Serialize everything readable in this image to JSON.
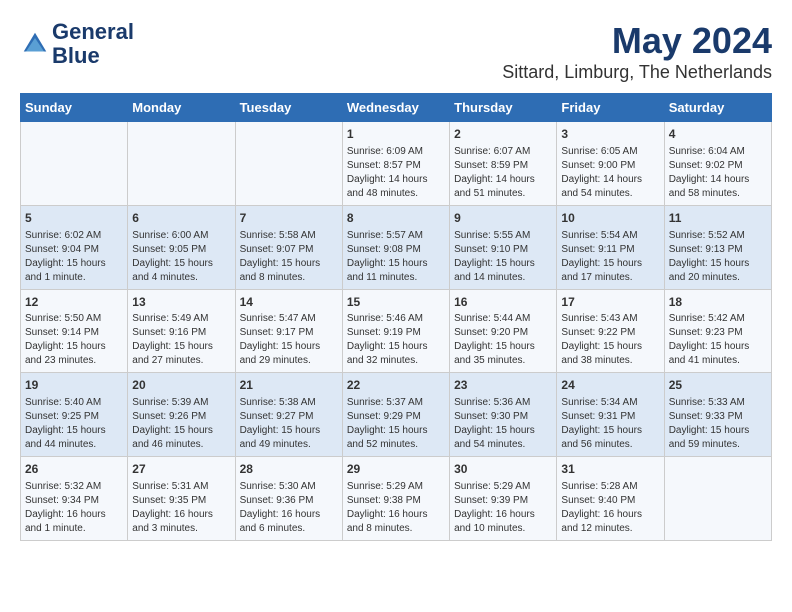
{
  "header": {
    "logo_line1": "General",
    "logo_line2": "Blue",
    "title": "May 2024",
    "subtitle": "Sittard, Limburg, The Netherlands"
  },
  "days_of_week": [
    "Sunday",
    "Monday",
    "Tuesday",
    "Wednesday",
    "Thursday",
    "Friday",
    "Saturday"
  ],
  "weeks": [
    [
      {
        "day": "",
        "info": ""
      },
      {
        "day": "",
        "info": ""
      },
      {
        "day": "",
        "info": ""
      },
      {
        "day": "1",
        "info": "Sunrise: 6:09 AM\nSunset: 8:57 PM\nDaylight: 14 hours\nand 48 minutes."
      },
      {
        "day": "2",
        "info": "Sunrise: 6:07 AM\nSunset: 8:59 PM\nDaylight: 14 hours\nand 51 minutes."
      },
      {
        "day": "3",
        "info": "Sunrise: 6:05 AM\nSunset: 9:00 PM\nDaylight: 14 hours\nand 54 minutes."
      },
      {
        "day": "4",
        "info": "Sunrise: 6:04 AM\nSunset: 9:02 PM\nDaylight: 14 hours\nand 58 minutes."
      }
    ],
    [
      {
        "day": "5",
        "info": "Sunrise: 6:02 AM\nSunset: 9:04 PM\nDaylight: 15 hours\nand 1 minute."
      },
      {
        "day": "6",
        "info": "Sunrise: 6:00 AM\nSunset: 9:05 PM\nDaylight: 15 hours\nand 4 minutes."
      },
      {
        "day": "7",
        "info": "Sunrise: 5:58 AM\nSunset: 9:07 PM\nDaylight: 15 hours\nand 8 minutes."
      },
      {
        "day": "8",
        "info": "Sunrise: 5:57 AM\nSunset: 9:08 PM\nDaylight: 15 hours\nand 11 minutes."
      },
      {
        "day": "9",
        "info": "Sunrise: 5:55 AM\nSunset: 9:10 PM\nDaylight: 15 hours\nand 14 minutes."
      },
      {
        "day": "10",
        "info": "Sunrise: 5:54 AM\nSunset: 9:11 PM\nDaylight: 15 hours\nand 17 minutes."
      },
      {
        "day": "11",
        "info": "Sunrise: 5:52 AM\nSunset: 9:13 PM\nDaylight: 15 hours\nand 20 minutes."
      }
    ],
    [
      {
        "day": "12",
        "info": "Sunrise: 5:50 AM\nSunset: 9:14 PM\nDaylight: 15 hours\nand 23 minutes."
      },
      {
        "day": "13",
        "info": "Sunrise: 5:49 AM\nSunset: 9:16 PM\nDaylight: 15 hours\nand 27 minutes."
      },
      {
        "day": "14",
        "info": "Sunrise: 5:47 AM\nSunset: 9:17 PM\nDaylight: 15 hours\nand 29 minutes."
      },
      {
        "day": "15",
        "info": "Sunrise: 5:46 AM\nSunset: 9:19 PM\nDaylight: 15 hours\nand 32 minutes."
      },
      {
        "day": "16",
        "info": "Sunrise: 5:44 AM\nSunset: 9:20 PM\nDaylight: 15 hours\nand 35 minutes."
      },
      {
        "day": "17",
        "info": "Sunrise: 5:43 AM\nSunset: 9:22 PM\nDaylight: 15 hours\nand 38 minutes."
      },
      {
        "day": "18",
        "info": "Sunrise: 5:42 AM\nSunset: 9:23 PM\nDaylight: 15 hours\nand 41 minutes."
      }
    ],
    [
      {
        "day": "19",
        "info": "Sunrise: 5:40 AM\nSunset: 9:25 PM\nDaylight: 15 hours\nand 44 minutes."
      },
      {
        "day": "20",
        "info": "Sunrise: 5:39 AM\nSunset: 9:26 PM\nDaylight: 15 hours\nand 46 minutes."
      },
      {
        "day": "21",
        "info": "Sunrise: 5:38 AM\nSunset: 9:27 PM\nDaylight: 15 hours\nand 49 minutes."
      },
      {
        "day": "22",
        "info": "Sunrise: 5:37 AM\nSunset: 9:29 PM\nDaylight: 15 hours\nand 52 minutes."
      },
      {
        "day": "23",
        "info": "Sunrise: 5:36 AM\nSunset: 9:30 PM\nDaylight: 15 hours\nand 54 minutes."
      },
      {
        "day": "24",
        "info": "Sunrise: 5:34 AM\nSunset: 9:31 PM\nDaylight: 15 hours\nand 56 minutes."
      },
      {
        "day": "25",
        "info": "Sunrise: 5:33 AM\nSunset: 9:33 PM\nDaylight: 15 hours\nand 59 minutes."
      }
    ],
    [
      {
        "day": "26",
        "info": "Sunrise: 5:32 AM\nSunset: 9:34 PM\nDaylight: 16 hours\nand 1 minute."
      },
      {
        "day": "27",
        "info": "Sunrise: 5:31 AM\nSunset: 9:35 PM\nDaylight: 16 hours\nand 3 minutes."
      },
      {
        "day": "28",
        "info": "Sunrise: 5:30 AM\nSunset: 9:36 PM\nDaylight: 16 hours\nand 6 minutes."
      },
      {
        "day": "29",
        "info": "Sunrise: 5:29 AM\nSunset: 9:38 PM\nDaylight: 16 hours\nand 8 minutes."
      },
      {
        "day": "30",
        "info": "Sunrise: 5:29 AM\nSunset: 9:39 PM\nDaylight: 16 hours\nand 10 minutes."
      },
      {
        "day": "31",
        "info": "Sunrise: 5:28 AM\nSunset: 9:40 PM\nDaylight: 16 hours\nand 12 minutes."
      },
      {
        "day": "",
        "info": ""
      }
    ]
  ]
}
